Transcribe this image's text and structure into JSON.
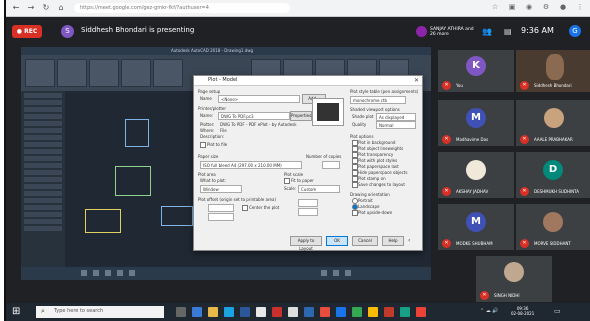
{
  "browser": {
    "url": "https://meet.google.com/gez-gmkr-fkf/?authuser=4"
  },
  "meet": {
    "rec_label": "REC",
    "presenter_initial": "S",
    "presenting_text": "Siddhesh Bhondari is presenting",
    "user_name": "SANJAY ATHIRA and 26 more",
    "clock": "9:36 AM",
    "self_initial": "G"
  },
  "cad": {
    "window_title": "Autodesk AutoCAD 2018 - Drawing1.dwg"
  },
  "print_dialog": {
    "title": "Plot - Model",
    "labels": {
      "page_setup": "Page setup",
      "name": "Name",
      "name_value": "<None>",
      "add_btn": "Add...",
      "printer_plotter": "Printer/plotter",
      "printer_name": "Name:",
      "printer_value": "DWG To PDF.pc3",
      "properties_btn": "Properties...",
      "plotter": "Plotter:",
      "plotter_value": "DWG To PDF - PDF ePlot - by Autodesk",
      "where": "Where:",
      "where_value": "File",
      "description": "Description:",
      "plot_to_file": "Plot to file",
      "paper_size": "Paper size",
      "paper_value": "ISO full bleed A4 (297.00 x 210.00 MM)",
      "copies": "Number of copies",
      "plot_area": "Plot area",
      "what_to_plot": "What to plot:",
      "what_value": "Window",
      "plot_scale": "Plot scale",
      "fit_to_paper": "Fit to paper",
      "scale": "Scale:",
      "scale_value": "Custom",
      "plot_offset": "Plot offset (origin set to printable area)",
      "center_plot": "Center the plot",
      "plot_style_table": "Plot style table (pen assignments)",
      "style_value": "monochrome.ctb",
      "shaded_viewport": "Shaded viewport options",
      "shade_plot": "Shade plot",
      "shade_value": "As displayed",
      "quality": "Quality",
      "quality_value": "Normal",
      "plot_options": "Plot options",
      "opt1": "Plot in background",
      "opt2": "Plot object lineweights",
      "opt3": "Plot transparency",
      "opt4": "Plot with plot styles",
      "opt5": "Plot paperspace last",
      "opt6": "Hide paperspace objects",
      "opt7": "Plot stamp on",
      "opt8": "Save changes to layout",
      "orientation": "Drawing orientation",
      "portrait": "Portrait",
      "landscape": "Landscape",
      "upside_down": "Plot upside-down",
      "apply_btn": "Apply to Layout",
      "ok_btn": "OK",
      "cancel_btn": "Cancel",
      "help_btn": "Help"
    }
  },
  "participants": [
    {
      "name": "You",
      "initial": "K",
      "color": "#7e57c2"
    },
    {
      "name": "Siddhesh Bhondari",
      "initial": "",
      "color": "#5a4a3a"
    },
    {
      "name": "Madhavime Das",
      "initial": "M",
      "color": "#3f51b5"
    },
    {
      "name": "AAALE PRABHAKAR",
      "initial": "",
      "color": "#6d5a48"
    },
    {
      "name": "AKSHAY JADHAV",
      "initial": "",
      "color": "#3a3a3a"
    },
    {
      "name": "DESHMUKH SUDHINTA",
      "initial": "D",
      "color": "#00897b"
    },
    {
      "name": "MODKE SHUBHAM",
      "initial": "M",
      "color": "#3f51b5"
    },
    {
      "name": "MORVE SIDDHANT",
      "initial": "",
      "color": "#6a5040"
    },
    {
      "name": "SINGH NIDHI",
      "initial": "",
      "color": "#7a6656"
    }
  ],
  "taskbar": {
    "search_placeholder": "Type here to search",
    "tray_time": "09:36",
    "tray_date": "02-08-2021"
  }
}
